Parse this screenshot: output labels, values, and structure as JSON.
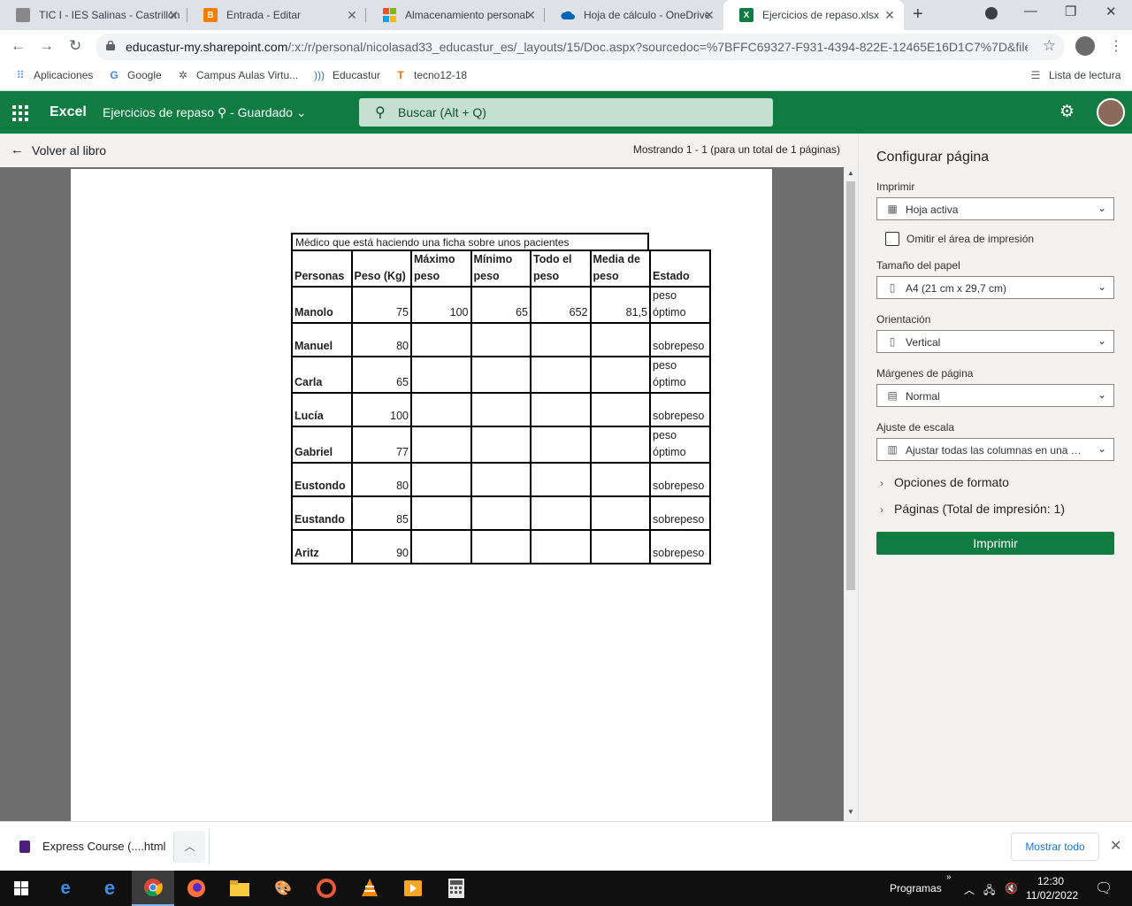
{
  "browser": {
    "tabs": [
      {
        "title": "TIC I - IES Salinas - Castrillón",
        "icon": "classroom-avatar-icon",
        "active": false
      },
      {
        "title": "Entrada - Editar",
        "icon": "blogger-icon",
        "active": false
      },
      {
        "title": "Almacenamiento personal",
        "icon": "microsoft-icon",
        "active": false
      },
      {
        "title": "Hoja de cálculo - OneDrive",
        "icon": "onedrive-icon",
        "active": false
      },
      {
        "title": "Ejercicios de repaso.xlsx",
        "icon": "excel-icon",
        "active": true
      }
    ],
    "url_domain": "educastur-my.sharepoint.com",
    "url_path": "/:x:/r/personal/nicolasad33_educastur_es/_layouts/15/Doc.aspx?sourcedoc=%7BFFC69327-F931-4394-822E-12465E16D1C7%7D&file=...",
    "bookmarks": [
      {
        "label": "Aplicaciones",
        "icon": "apps-grid-icon"
      },
      {
        "label": "Google",
        "icon": "google-icon"
      },
      {
        "label": "Campus Aulas Virtu...",
        "icon": "campus-icon"
      },
      {
        "label": "Educastur",
        "icon": "educastur-icon"
      },
      {
        "label": "tecno12-18",
        "icon": "tecno-icon"
      }
    ],
    "reading_list": "Lista de lectura"
  },
  "excel": {
    "app_name": "Excel",
    "doc_title": "Ejercicios de repaso",
    "save_status": "- Guardado",
    "search_placeholder": "Buscar (Alt + Q)",
    "accent": "#107c41"
  },
  "print_preview": {
    "back_label": "Volver al libro",
    "page_status": "Mostrando 1 - 1 (para un total de 1 páginas)",
    "sheet": {
      "title": "Médico que está haciendo una ficha sobre unos pacientes",
      "headers": [
        [
          "Personas"
        ],
        [
          "Peso (Kg)"
        ],
        [
          "Máximo",
          "peso"
        ],
        [
          "Mínimo",
          "peso"
        ],
        [
          "Todo el",
          "peso"
        ],
        [
          "Media de",
          "peso"
        ],
        [
          "Estado"
        ]
      ],
      "rows": [
        {
          "persona": "Manolo",
          "peso": "75",
          "maximo": "100",
          "minimo": "65",
          "todo": "652",
          "media": "81,5",
          "estado": [
            "peso",
            "óptimo"
          ]
        },
        {
          "persona": "Manuel",
          "peso": "80",
          "maximo": "",
          "minimo": "",
          "todo": "",
          "media": "",
          "estado": [
            "sobrepeso"
          ]
        },
        {
          "persona": "Carla",
          "peso": "65",
          "maximo": "",
          "minimo": "",
          "todo": "",
          "media": "",
          "estado": [
            "peso",
            "óptimo"
          ]
        },
        {
          "persona": "Lucía",
          "peso": "100",
          "maximo": "",
          "minimo": "",
          "todo": "",
          "media": "",
          "estado": [
            "sobrepeso"
          ]
        },
        {
          "persona": "Gabriel",
          "peso": "77",
          "maximo": "",
          "minimo": "",
          "todo": "",
          "media": "",
          "estado": [
            "peso",
            "óptimo"
          ]
        },
        {
          "persona": "Eustondo",
          "peso": "80",
          "maximo": "",
          "minimo": "",
          "todo": "",
          "media": "",
          "estado": [
            "sobrepeso"
          ]
        },
        {
          "persona": "Eustando",
          "peso": "85",
          "maximo": "",
          "minimo": "",
          "todo": "",
          "media": "",
          "estado": [
            "sobrepeso"
          ]
        },
        {
          "persona": "Aritz",
          "peso": "90",
          "maximo": "",
          "minimo": "",
          "todo": "",
          "media": "",
          "estado": [
            "sobrepeso"
          ]
        }
      ]
    }
  },
  "page_setup": {
    "title": "Configurar página",
    "print_label": "Imprimir",
    "print_value": "Hoja activa",
    "omit_area_label": "Omitir el área de impresión",
    "omit_area_checked": false,
    "paper_label": "Tamaño del papel",
    "paper_value": "A4 (21 cm x 29,7 cm)",
    "orientation_label": "Orientación",
    "orientation_value": "Vertical",
    "margins_label": "Márgenes de página",
    "margins_value": "Normal",
    "scale_label": "Ajuste de escala",
    "scale_value": "Ajustar todas las columnas en una pá...",
    "format_options": "Opciones de formato",
    "pages_label": "Páginas (Total de impresión: 1)",
    "print_button": "Imprimir"
  },
  "downloads": {
    "file_name": "Express Course (....html",
    "show_all": "Mostrar todo"
  },
  "taskbar": {
    "programs_label": "Programas",
    "time": "12:30",
    "date": "11/02/2022"
  }
}
